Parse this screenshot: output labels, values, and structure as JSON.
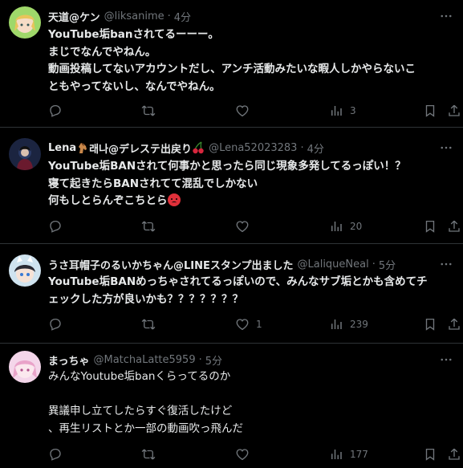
{
  "tweets": [
    {
      "name": "天道@ケン",
      "handle": "@liksanime",
      "dot": "·",
      "time": "4分",
      "lines": [
        "YouTube垢banされてるーーー。",
        "まじでなんでやねん。",
        "動画投稿してないアカウントだし、アンチ活動みたいな暇人しかやらないこ",
        "ともやってないし、なんでやねん。"
      ],
      "bold": true,
      "views": "3",
      "likes": ""
    },
    {
      "name_part1": "Lena",
      "name_part2": "래나@デレステ出戻り",
      "handle": "@Lena52023283",
      "dot": "·",
      "time": "4分",
      "lines": [
        "YouTube垢BANされて何事かと思ったら同じ現象多発してるっぽい！？",
        "寝て起きたらBANされてて混乱でしかない",
        "何もしとらんぞこちとら"
      ],
      "views": "20",
      "likes": ""
    },
    {
      "name": "うさ耳帽子のるいかちゃん@LINEスタンプ出ました",
      "handle": "@LaliqueNeal",
      "dot": "·",
      "time": "5分",
      "lines": [
        "YouTube垢BANめっちゃされてるっぽいので、みんなサブ垢とかも含めてチ",
        "ェックした方が良いかも？？？？？？？"
      ],
      "views": "239",
      "likes": "1"
    },
    {
      "name": "まっちゃ",
      "handle": "@MatchaLatte5959",
      "dot": "·",
      "time": "5分",
      "lines": [
        "みんなYoutube垢banくらってるのか",
        "",
        "異議申し立てしたらすぐ復活したけど",
        "、再生リストとか一部の動画吹っ飛んだ"
      ],
      "views": "177",
      "likes": ""
    }
  ],
  "colors": {
    "background": "#000000",
    "text": "#e7e9ea",
    "muted": "#71767b",
    "border": "#2f3336"
  },
  "icons": [
    "more-icon",
    "reply-icon",
    "retweet-icon",
    "like-icon",
    "views-icon",
    "bookmark-icon",
    "share-icon"
  ]
}
